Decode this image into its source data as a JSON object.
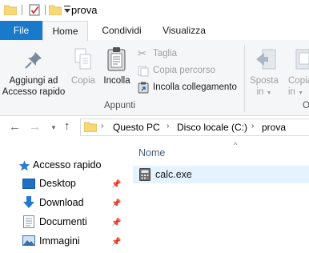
{
  "window": {
    "title": "prova"
  },
  "ribbon_tabs": [
    "File",
    "Home",
    "Condividi",
    "Visualizza"
  ],
  "clipboard": {
    "pin_label_1": "Aggiungi ad",
    "pin_label_2": "Accesso rapido",
    "copy_label": "Copia",
    "paste_label": "Incolla",
    "cut_label": "Taglia",
    "copy_path_label": "Copia percorso",
    "paste_shortcut_label": "Incolla collegamento",
    "group_label": "Appunti"
  },
  "organize": {
    "move_label_1": "Sposta",
    "move_label_2": "in",
    "copy_label_1": "Copia",
    "copy_label_2": "in",
    "group_label_partial": "O"
  },
  "address": {
    "crumbs": [
      "Questo PC",
      "Disco locale (C:)",
      "prova"
    ]
  },
  "file_list": {
    "column_name": "Nome",
    "files": [
      {
        "name": "calc.exe"
      }
    ]
  },
  "nav_pane": {
    "quick_access": "Accesso rapido",
    "items": [
      "Desktop",
      "Download",
      "Documenti",
      "Immagini"
    ]
  },
  "colors": {
    "accent": "#1979ca",
    "folder": "#f8d775",
    "selection": "#e5f3ff"
  }
}
